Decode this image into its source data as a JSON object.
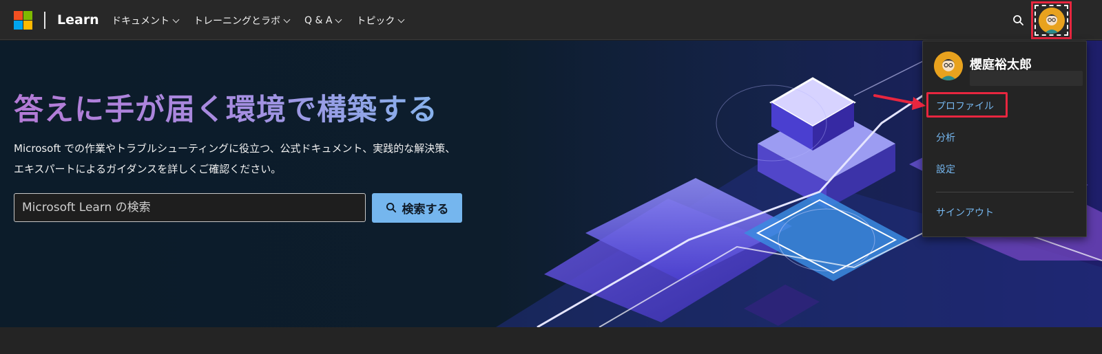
{
  "header": {
    "brand": "Learn",
    "nav": [
      {
        "label": "ドキュメント"
      },
      {
        "label": "トレーニングとラボ"
      },
      {
        "label": "Q & A"
      },
      {
        "label": "トピック"
      }
    ],
    "icons": {
      "search": "search-icon",
      "avatar": "avatar-icon",
      "logo": "microsoft-logo-icon"
    }
  },
  "hero": {
    "title": "答えに手が届く環境で構築する",
    "description": "Microsoft での作業やトラブルシューティングに役立つ、公式ドキュメント、実践的な解決策、エキスパートによるガイダンスを詳しくご確認ください。",
    "search_placeholder": "Microsoft Learn の検索",
    "search_button": "検索する"
  },
  "profile_menu": {
    "user_name": "櫻庭裕太郎",
    "items": [
      {
        "label": "プロファイル"
      },
      {
        "label": "分析"
      },
      {
        "label": "設定"
      }
    ],
    "signout": "サインアウト"
  },
  "colors": {
    "accent": "#75b6ee",
    "highlight": "#e8263f",
    "header_bg": "#282828",
    "hero_bg": "#0c1c2a"
  }
}
